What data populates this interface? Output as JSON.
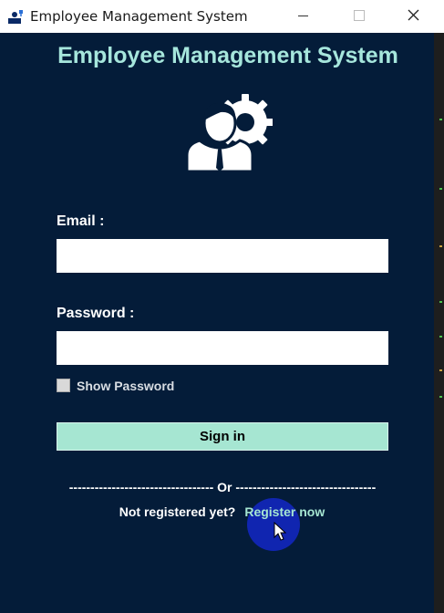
{
  "window": {
    "title": "Employee Management System"
  },
  "icons": {
    "app": "employee-app-icon",
    "logo": "employee-gear-icon",
    "minimize": "minimize-icon",
    "maximize": "maximize-icon",
    "close": "close-icon",
    "cursor": "mouse-pointer-icon"
  },
  "colors": {
    "background": "#041c39",
    "heading": "#a6e6dc",
    "button": "#a6e6d2",
    "link": "#a6e6d2",
    "click_indicator": "#1428d2"
  },
  "form": {
    "heading": "Employee Management System",
    "email_label": "Email :",
    "email_value": "",
    "password_label": "Password :",
    "password_value": "",
    "show_password_label": "Show Password",
    "show_password_checked": false,
    "signin_label": "Sign in",
    "divider": "---------------------------------- Or ---------------------------------",
    "not_registered": "Not registered yet?",
    "register_link": "Register now"
  }
}
